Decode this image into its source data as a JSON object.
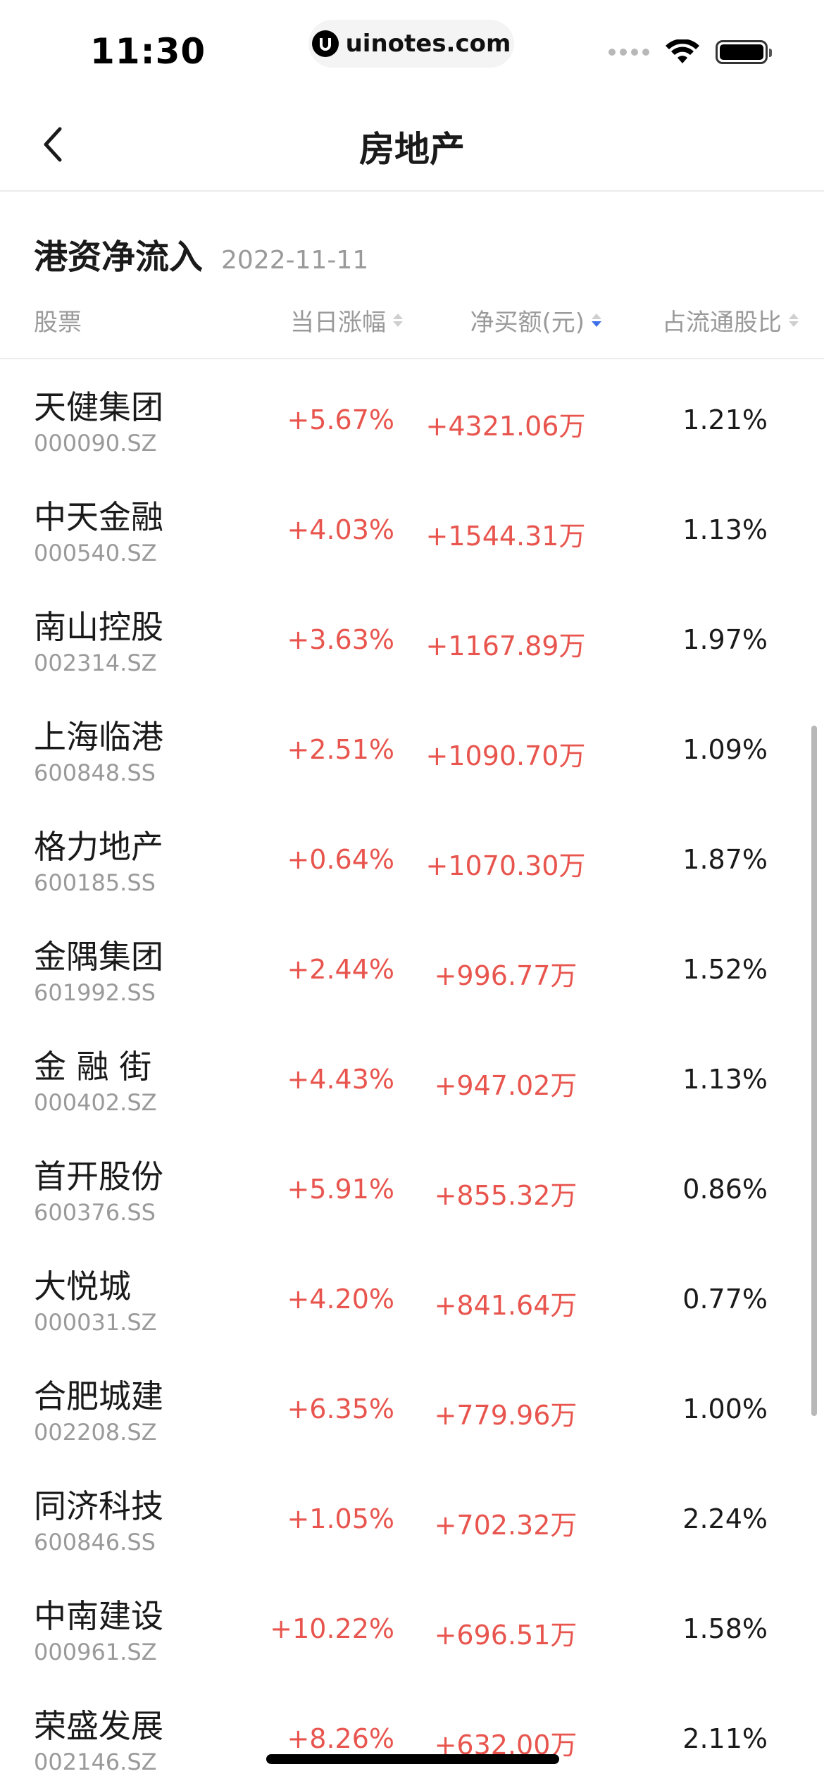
{
  "status_bar": {
    "time": "11:30",
    "url": "uinotes.com"
  },
  "nav": {
    "title": "房地产"
  },
  "section": {
    "title": "港资净流入",
    "date": "2022-11-11"
  },
  "table": {
    "headers": {
      "stock": "股票",
      "change": "当日涨幅",
      "net_buy": "净买额(元)",
      "ratio": "占流通股比"
    },
    "sorted_column": "net_buy",
    "sort_direction": "desc",
    "rows": [
      {
        "name": "天健集团",
        "code": "000090.SZ",
        "change": "+5.67%",
        "net_buy": "+4321.06万",
        "ratio": "1.21%"
      },
      {
        "name": "中天金融",
        "code": "000540.SZ",
        "change": "+4.03%",
        "net_buy": "+1544.31万",
        "ratio": "1.13%"
      },
      {
        "name": "南山控股",
        "code": "002314.SZ",
        "change": "+3.63%",
        "net_buy": "+1167.89万",
        "ratio": "1.97%"
      },
      {
        "name": "上海临港",
        "code": "600848.SS",
        "change": "+2.51%",
        "net_buy": "+1090.70万",
        "ratio": "1.09%"
      },
      {
        "name": "格力地产",
        "code": "600185.SS",
        "change": "+0.64%",
        "net_buy": "+1070.30万",
        "ratio": "1.87%"
      },
      {
        "name": "金隅集团",
        "code": "601992.SS",
        "change": "+2.44%",
        "net_buy": "+996.77万",
        "ratio": "1.52%"
      },
      {
        "name": "金 融 街",
        "code": "000402.SZ",
        "change": "+4.43%",
        "net_buy": "+947.02万",
        "ratio": "1.13%"
      },
      {
        "name": "首开股份",
        "code": "600376.SS",
        "change": "+5.91%",
        "net_buy": "+855.32万",
        "ratio": "0.86%"
      },
      {
        "name": "大悦城",
        "code": "000031.SZ",
        "change": "+4.20%",
        "net_buy": "+841.64万",
        "ratio": "0.77%"
      },
      {
        "name": "合肥城建",
        "code": "002208.SZ",
        "change": "+6.35%",
        "net_buy": "+779.96万",
        "ratio": "1.00%"
      },
      {
        "name": "同济科技",
        "code": "600846.SS",
        "change": "+1.05%",
        "net_buy": "+702.32万",
        "ratio": "2.24%"
      },
      {
        "name": "中南建设",
        "code": "000961.SZ",
        "change": "+10.22%",
        "net_buy": "+696.51万",
        "ratio": "1.58%"
      },
      {
        "name": "荣盛发展",
        "code": "002146.SZ",
        "change": "+8.26%",
        "net_buy": "+632.00万",
        "ratio": "2.11%"
      }
    ]
  },
  "colors": {
    "up": "#e8554e",
    "text": "#1a1a1a",
    "muted": "#9a9a9a",
    "sort_active": "#3d6fe8"
  },
  "icons": {
    "back": "chevron-left-icon",
    "sort": "sort-arrows-icon",
    "wifi": "wifi-icon",
    "battery": "battery-icon",
    "signal": "cellular-signal-icon",
    "site_logo": "uinotes-logo-icon"
  }
}
